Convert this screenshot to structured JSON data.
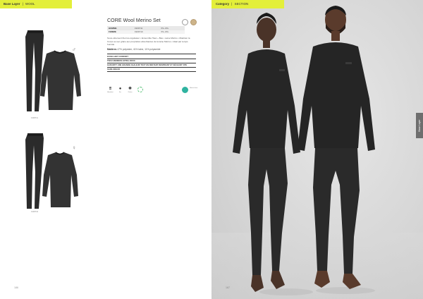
{
  "left_tab": {
    "category": "Base Layer",
    "separator": "|",
    "subcategory": "WOOL"
  },
  "product": {
    "title": "CORE Wool Merino Set",
    "specs": [
      {
        "label": "HOMME",
        "code": "1909711",
        "sizes": "XS–3XL"
      },
      {
        "label": "FEMME",
        "code": "1909710",
        "sizes": "XS–3XL"
      }
    ],
    "description": "Sous-vêtement thermo-régulateur • Ensemble Haut + Bas • Laine Mérino • Maintien la Corps au sec grâce aux propriétés absorbantes de la laine Mérino • Idéal par temps humide.",
    "material_label": "Matières",
    "material": "47% polyester, 41% laine, 11% polyamide",
    "features": [
      "EXCELLENT CONFORT",
      "TISSU MERINOS EXTRA-DOUX",
      "GARANTIT UNE GRANDE CHALEUR TOUT EN RESTANT RESPIRANT ET SÉCHANT VITE",
      "SANS ODEUR"
    ],
    "icons": [
      {
        "name": "moisture-icon",
        "glyph": "⩩",
        "caption": "Absorbant"
      },
      {
        "name": "drop-icon",
        "glyph": "●",
        "caption": "Sec"
      },
      {
        "name": "warmth-icon",
        "glyph": "✺",
        "caption": "Chaleur"
      },
      {
        "name": "recycle-icon",
        "glyph": "",
        "caption": ""
      }
    ],
    "eco_label": "Mérinos laine"
  },
  "men_code": "1909711",
  "women_code": "1909710",
  "page_left": "186",
  "right_tab": {
    "category": "Category",
    "separator": "|",
    "subcategory": "SECTION"
  },
  "side_tab": "Base Layer",
  "page_right": "187",
  "colors": {
    "accent": "#e3ef3a",
    "garment": "#2b2b2b",
    "background_right": "#d7d7d7"
  }
}
